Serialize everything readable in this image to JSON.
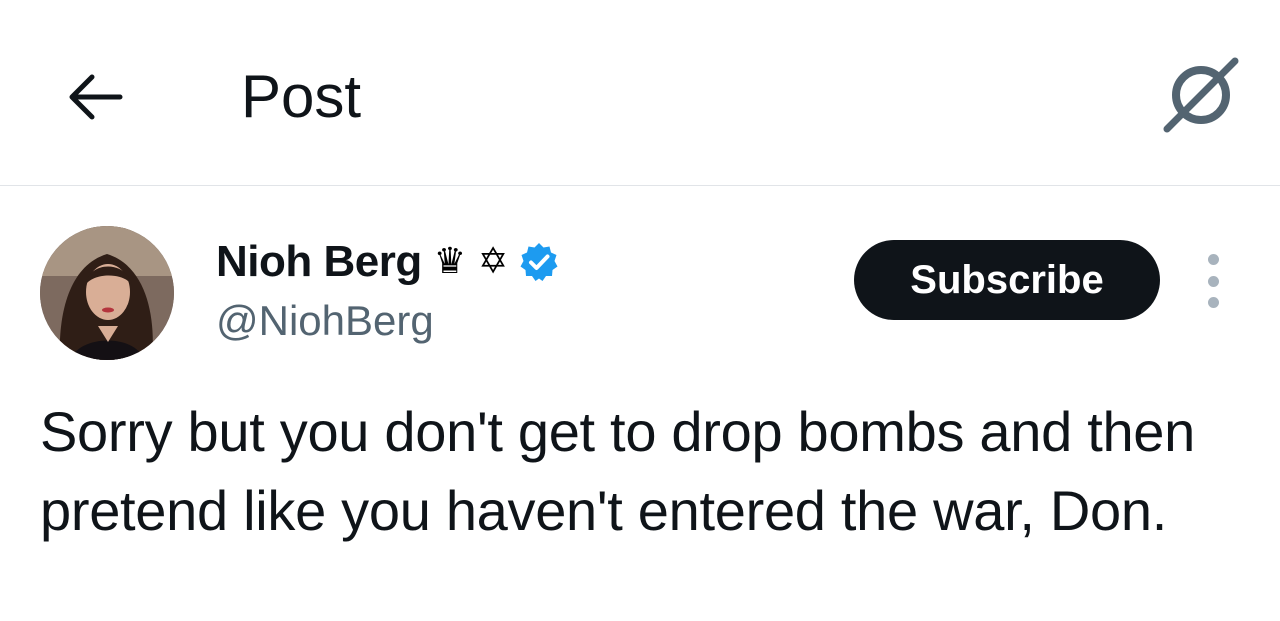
{
  "header": {
    "title": "Post",
    "back_icon": "arrow-left-icon",
    "grok_icon": "grok-icon"
  },
  "post": {
    "author": {
      "display_name": "Nioh Berg",
      "name_emojis": [
        "♛",
        "✡"
      ],
      "handle": "@NiohBerg",
      "verified": true,
      "verified_color": "#1d9bf0"
    },
    "subscribe_label": "Subscribe",
    "more_icon": "more-vertical-icon",
    "text": "Sorry but you don't get to drop bombs and then pretend like you haven't entered the war, Don."
  },
  "colors": {
    "text_primary": "#0f1419",
    "text_secondary": "#536471",
    "button_bg": "#0f1419",
    "divider": "#e1e4e8"
  }
}
